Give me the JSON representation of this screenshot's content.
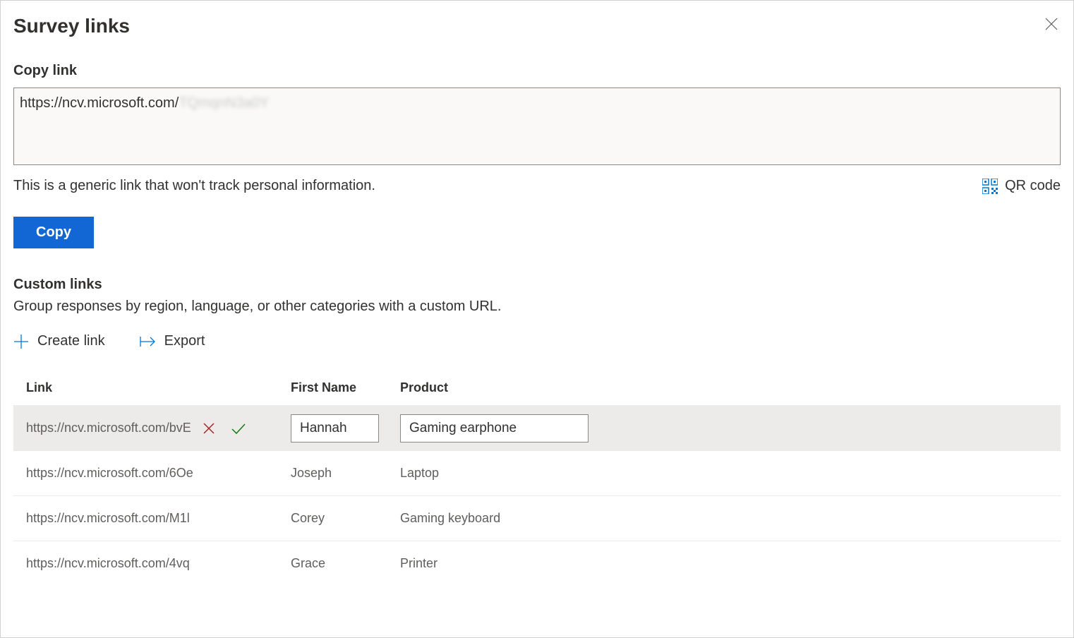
{
  "panel": {
    "title": "Survey links"
  },
  "copyLink": {
    "label": "Copy link",
    "urlPrefix": "https://ncv.microsoft.com/",
    "urlSuffixBlurred": "TQmqnN3a0Y",
    "infoText": "This is a generic link that won't track personal information.",
    "qrLabel": "QR code",
    "copyButton": "Copy"
  },
  "customLinks": {
    "title": "Custom links",
    "description": "Group responses by region, language, or other categories with a custom URL.",
    "createLink": "Create link",
    "exportLink": "Export"
  },
  "table": {
    "headers": {
      "link": "Link",
      "firstName": "First Name",
      "product": "Product"
    },
    "rows": [
      {
        "link": "https://ncv.microsoft.com/bvE",
        "firstName": "Hannah",
        "product": "Gaming earphone",
        "editing": true
      },
      {
        "link": "https://ncv.microsoft.com/6Oe",
        "firstName": "Joseph",
        "product": "Laptop",
        "editing": false
      },
      {
        "link": "https://ncv.microsoft.com/M1l",
        "firstName": "Corey",
        "product": "Gaming keyboard",
        "editing": false
      },
      {
        "link": "https://ncv.microsoft.com/4vq",
        "firstName": "Grace",
        "product": "Printer",
        "editing": false
      }
    ]
  }
}
